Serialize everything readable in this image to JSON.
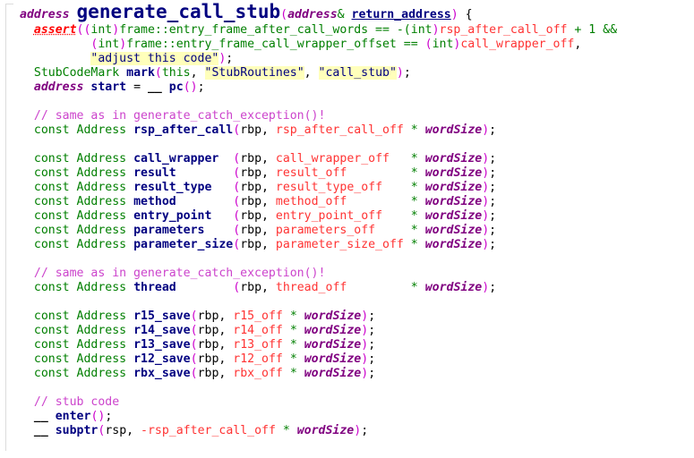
{
  "document": {
    "kind": "source-code-listing",
    "language": "C++",
    "function_name": "generate_call_stub"
  },
  "colors": {
    "background": "#ffffff",
    "keyword_green": "#007f00",
    "identifier_navy": "#000080",
    "type_purple": "#800080",
    "paren_magenta": "#cc00cc",
    "offset_red": "#ff3333",
    "comment_magenta": "#cc44cc",
    "assert_red": "#ff0000",
    "string_highlight": "#ffffbb",
    "gutter_rule": "#dcdcdc"
  },
  "signature": {
    "return_type": "address",
    "name": "generate_call_stub",
    "open_paren": "(",
    "param_type": "address",
    "ampersand": "&",
    "param_name": "return_address",
    "close_paren": ")",
    "open_brace": "{"
  },
  "assert": {
    "keyword": "assert",
    "open": "((",
    "cast1_kw": "int",
    "cast1_close": ")",
    "lhs1": "frame::entry_frame_after_call_words",
    "eq1": " == ",
    "neg": "-(",
    "cast2_kw": "int",
    "cast2_close": ")",
    "rhs1": "rsp_after_call_off",
    "plus": " + ",
    "one": "1",
    "andand": " &&",
    "cast3_open": "(",
    "cast3_kw": "int",
    "cast3_close": ")",
    "lhs2": "frame::entry_frame_call_wrapper_offset",
    "eq2": " == ",
    "cast4_open": "(",
    "cast4_kw": "int",
    "cast4_close": ")",
    "rhs2": "call_wrapper_off",
    "comma": ",",
    "message": "\"adjust this code\"",
    "tail_paren": ")",
    "tail_semi": ";"
  },
  "stub_code_mark": {
    "type": "StubCodeMark",
    "var": "mark",
    "open": "(",
    "arg_this": "this",
    "comma1": ", ",
    "arg_group": "\"StubRoutines\"",
    "comma2": ", ",
    "arg_name": "\"call_stub\"",
    "close": ")",
    "semi": ";"
  },
  "start_decl": {
    "type": "address",
    "name": "start",
    "assign": " = ",
    "macro": "__",
    "call": "pc",
    "parens": "()",
    "semi": ";"
  },
  "comments": {
    "same_as_catch_1": "// same as in generate_catch_exception()!",
    "same_as_catch_2": "// same as in generate_catch_exception()!",
    "stub_code": "// stub code"
  },
  "address_declarations": {
    "keyword_const": "const",
    "keyword_type": "Address",
    "base_register": "rbp",
    "multiply": "*",
    "word_size": "wordSize",
    "groups": [
      {
        "comment": "// same as in generate_catch_exception()!",
        "rows": [
          {
            "name": "rsp_after_call",
            "name_pad": "",
            "offset": "rsp_after_call_off",
            "offset_pad": " "
          }
        ]
      },
      {
        "comment": "",
        "rows": [
          {
            "name": "call_wrapper",
            "name_pad": "  ",
            "offset": "call_wrapper_off",
            "offset_pad": "   "
          },
          {
            "name": "result",
            "name_pad": "        ",
            "offset": "result_off",
            "offset_pad": "         "
          },
          {
            "name": "result_type",
            "name_pad": "   ",
            "offset": "result_type_off",
            "offset_pad": "    "
          },
          {
            "name": "method",
            "name_pad": "        ",
            "offset": "method_off",
            "offset_pad": "         "
          },
          {
            "name": "entry_point",
            "name_pad": "   ",
            "offset": "entry_point_off",
            "offset_pad": "    "
          },
          {
            "name": "parameters",
            "name_pad": "    ",
            "offset": "parameters_off",
            "offset_pad": "     "
          },
          {
            "name": "parameter_size",
            "name_pad": "",
            "offset": "parameter_size_off",
            "offset_pad": " "
          }
        ]
      },
      {
        "comment": "// same as in generate_catch_exception()!",
        "rows": [
          {
            "name": "thread",
            "name_pad": "        ",
            "offset": "thread_off",
            "offset_pad": "         "
          }
        ]
      },
      {
        "comment": "",
        "rows": [
          {
            "name": "r15_save",
            "name_pad": "",
            "offset": "r15_off",
            "offset_pad": " "
          },
          {
            "name": "r14_save",
            "name_pad": "",
            "offset": "r14_off",
            "offset_pad": " "
          },
          {
            "name": "r13_save",
            "name_pad": "",
            "offset": "r13_off",
            "offset_pad": " "
          },
          {
            "name": "r12_save",
            "name_pad": "",
            "offset": "r12_off",
            "offset_pad": " "
          },
          {
            "name": "rbx_save",
            "name_pad": "",
            "offset": "rbx_off",
            "offset_pad": " "
          }
        ]
      }
    ]
  },
  "stub_body": {
    "macro": "__",
    "enter_call": "enter",
    "enter_parens": "()",
    "enter_semi": ";",
    "subptr_call": "subptr",
    "subptr_open": "(",
    "subptr_reg": "rsp",
    "subptr_comma": ", ",
    "subptr_neg_offset": "-rsp_after_call_off",
    "subptr_mul": " * ",
    "subptr_wordsize": "wordSize",
    "subptr_close": ")",
    "subptr_semi": ";"
  }
}
